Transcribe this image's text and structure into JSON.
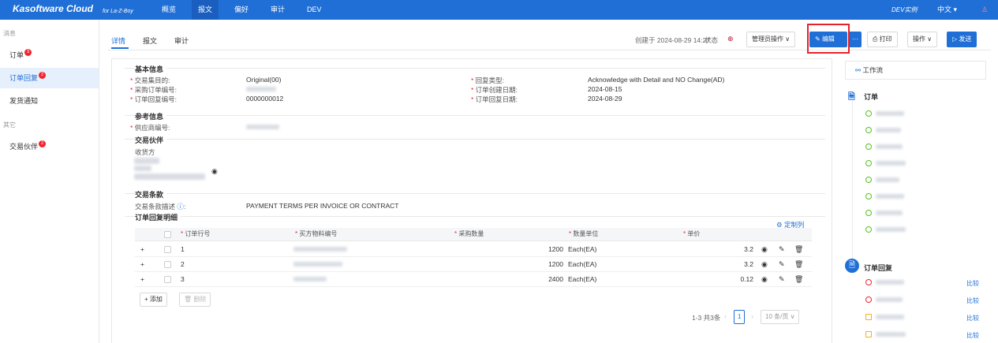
{
  "app": {
    "brand": "Kasoftware Cloud",
    "brand_sub": "for La-Z-Boy"
  },
  "topnav": [
    {
      "label": "概览"
    },
    {
      "label": "报文"
    },
    {
      "label": "偏好"
    },
    {
      "label": "审计"
    },
    {
      "label": "DEV"
    }
  ],
  "topright": {
    "env": "DEV实例",
    "lang": "中文 ▾"
  },
  "sidebar": {
    "group_messages": "消息",
    "items": [
      {
        "label": "订单",
        "badge": "3"
      },
      {
        "label": "订单回复",
        "badge": "2"
      },
      {
        "label": "发货通知",
        "badge": ""
      }
    ],
    "group_other": "其它",
    "other_items": [
      {
        "label": "交易伙伴",
        "badge": "2"
      }
    ]
  },
  "tabs": [
    {
      "label": "详情"
    },
    {
      "label": "报文"
    },
    {
      "label": "审计"
    }
  ],
  "header": {
    "created": "创建于 2024-08-29 14:27",
    "status_label": "状态",
    "admin_ops": "管理员操作 ∨",
    "edit": "编辑",
    "more": "···",
    "print": "打印",
    "ops": "操作 ∨",
    "send": "发送"
  },
  "basic": {
    "title": "基本信息",
    "purpose_label": "交易集目的:",
    "purpose_value": "Original(00)",
    "po_label": "采购订单编号:",
    "reply_no_label": "订单回复编号:",
    "reply_no_value": "0000000012",
    "reply_type_label": "回复类型:",
    "reply_type_value": "Acknowledge with Detail and NO Change(AD)",
    "order_date_label": "订单创建日期:",
    "order_date_value": "2024-08-15",
    "reply_date_label": "订单回复日期:",
    "reply_date_value": "2024-08-29"
  },
  "reference": {
    "title": "参考信息",
    "supplier_label": "供应商编号:"
  },
  "partner": {
    "title": "交易伙伴",
    "receiver_label": "收货方"
  },
  "terms": {
    "title": "交易条款",
    "desc_label": "交易条款描述",
    "desc_value": "PAYMENT TERMS PER INVOICE OR CONTRACT"
  },
  "detail": {
    "title": "订单回复明细",
    "customize": "定制列",
    "columns": [
      "订单行号",
      "买方物料编号",
      "采购数量",
      "数量单位",
      "单价"
    ],
    "rows": [
      {
        "line": "1",
        "qty": "1200",
        "unit": "Each(EA)",
        "price": "3.2"
      },
      {
        "line": "2",
        "qty": "1200",
        "unit": "Each(EA)",
        "price": "3.2"
      },
      {
        "line": "3",
        "qty": "2400",
        "unit": "Each(EA)",
        "price": "0.12"
      }
    ],
    "add": "+ 添加",
    "delete": "删除",
    "pagination": {
      "summary": "1-3 共3条",
      "page": "1",
      "page_size": "10 条/页 ∨"
    }
  },
  "workflow": {
    "title": "工作流",
    "order_title": "订单",
    "reply_title": "订单回复",
    "compare": "比较"
  }
}
